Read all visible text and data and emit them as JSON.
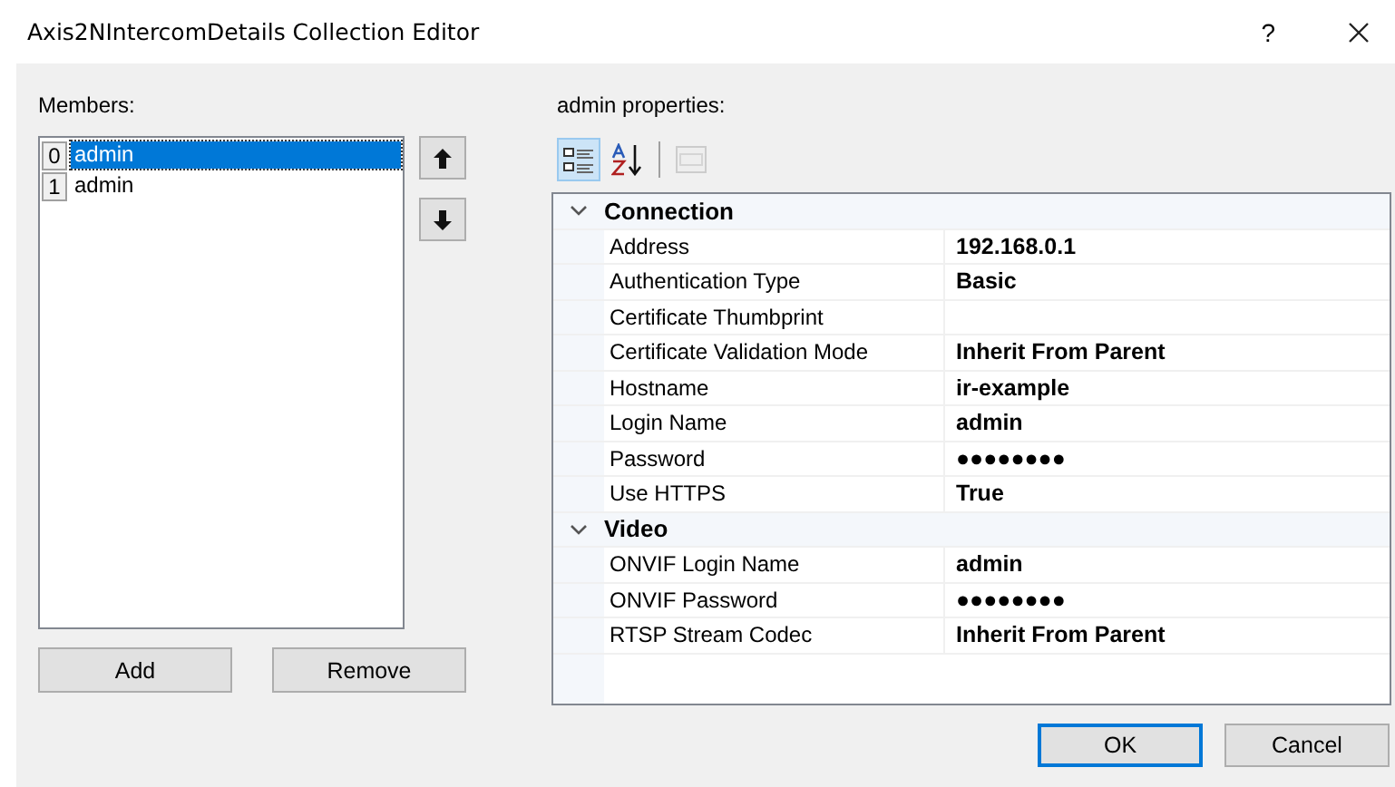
{
  "window": {
    "title": "Axis2NIntercomDetails Collection Editor",
    "help": "?"
  },
  "members": {
    "label": "Members:",
    "items": [
      {
        "index": "0",
        "name": "admin",
        "selected": true
      },
      {
        "index": "1",
        "name": "admin",
        "selected": false
      }
    ]
  },
  "member_buttons": [
    "Add",
    "Remove"
  ],
  "properties": {
    "label": "admin properties:",
    "toolbar": [
      {
        "kind": "categorized",
        "selected": true,
        "disabled": false
      },
      {
        "kind": "alphabetical",
        "selected": false,
        "disabled": false
      },
      {
        "kind": "pages",
        "selected": false,
        "disabled": true
      }
    ],
    "categories": [
      {
        "name": "Connection",
        "expanded": true,
        "properties": [
          {
            "name": "Address",
            "value": "192.168.0.1"
          },
          {
            "name": "Authentication Type",
            "value": "Basic"
          },
          {
            "name": "Certificate Thumbprint"
          },
          {
            "name": "Certificate Validation Mode",
            "value": "Inherit From Parent"
          },
          {
            "name": "Hostname",
            "value": "ir-example"
          },
          {
            "name": "Login Name",
            "value": "admin"
          },
          {
            "name": "Password",
            "value": "●●●●●●●●"
          },
          {
            "name": "Use HTTPS",
            "value": "True"
          }
        ]
      },
      {
        "name": "Video",
        "expanded": true,
        "properties": [
          {
            "name": "ONVIF Login Name",
            "value": "admin"
          },
          {
            "name": "ONVIF Password",
            "value": "●●●●●●●●"
          },
          {
            "name": "RTSP Stream Codec",
            "value": "Inherit From Parent"
          }
        ]
      }
    ]
  },
  "dialog_buttons": [
    {
      "label": "OK",
      "default": true
    },
    {
      "label": "Cancel",
      "default": false
    }
  ]
}
